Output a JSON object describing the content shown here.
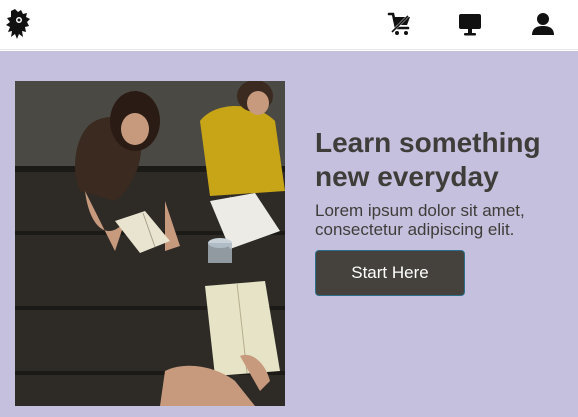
{
  "navbar": {
    "logo_icon": "lion-rampant-logo-icon",
    "icons": [
      "cart-icon",
      "desktop-icon",
      "user-icon"
    ]
  },
  "hero": {
    "background_color": "#c5c0dd",
    "image_description_icon": "students-reading-photo",
    "title": "Learn something new everyday",
    "text": "Lorem ipsum dolor sit amet, consectetur adipiscing elit.",
    "button_label": "Start Here",
    "button_color": "#45423d"
  }
}
